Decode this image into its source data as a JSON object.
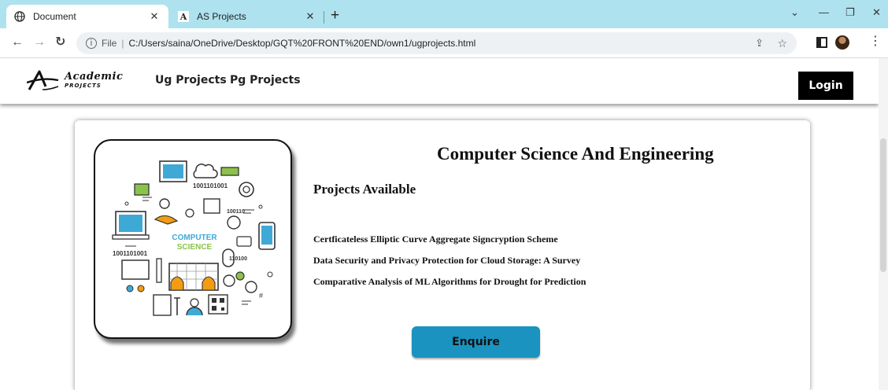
{
  "browser": {
    "tabs": [
      {
        "title": "Document",
        "active": true,
        "favicon": "globe-icon"
      },
      {
        "title": "AS Projects",
        "active": false,
        "favicon": "academic-logo-icon"
      }
    ],
    "address": {
      "file_label": "File",
      "url": "C:/Users/saina/OneDrive/Desktop/GQT%20FRONT%20END/own1/ugprojects.html"
    }
  },
  "site": {
    "logo": {
      "word1": "Academic",
      "word2": "PROJECTS"
    },
    "nav": [
      "Ug Projects",
      "Pg Projects"
    ],
    "login_label": "Login"
  },
  "card": {
    "title": "Computer Science And Engineering",
    "subtitle": "Projects Available",
    "image_caption": "COMPUTER\nSCIENCE",
    "image_text": {
      "line1": "COMPUTER",
      "line2": "SCIENCE",
      "binary1": "1001101001",
      "binary2": "100110",
      "binary3": "1001101001",
      "binary4": "110100",
      "binary5": "1001101001"
    },
    "projects": [
      "Certficateless Elliptic Curve Aggregate Signcryption Scheme",
      "Data Security and Privacy Protection for Cloud Storage: A Survey",
      "Comparative Analysis of ML Algorithms for Drought for Prediction"
    ],
    "enquire_label": "Enquire"
  },
  "colors": {
    "tabbar": "#aee2ee",
    "enquire_button": "#1a93c0",
    "login_button": "#000000",
    "illustration_accent_blue": "#3fa9d6",
    "illustration_accent_green": "#8bc34a",
    "illustration_accent_orange": "#f39c12"
  }
}
